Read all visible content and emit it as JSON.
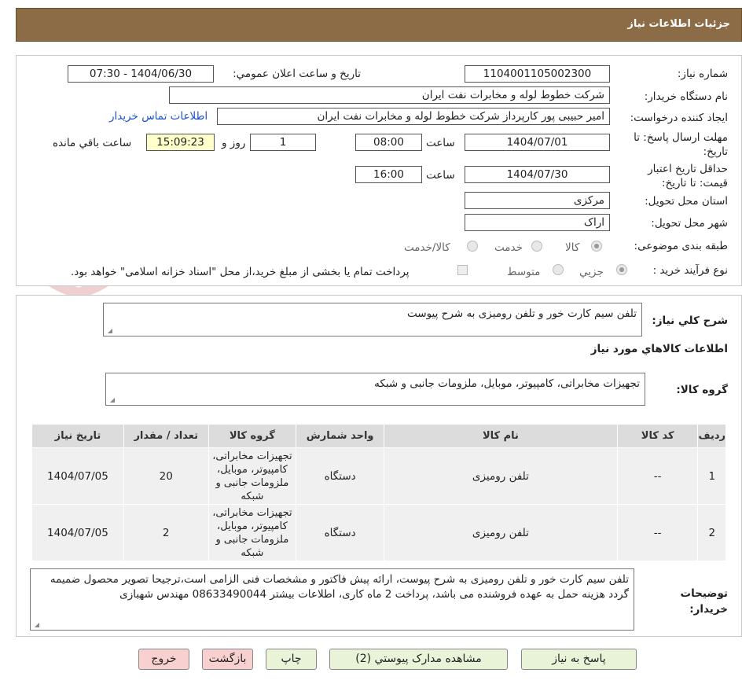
{
  "header": {
    "title": "جزئیات اطلاعات نیاز"
  },
  "form": {
    "need_number_label": "شماره نیاز:",
    "need_number": "1104001105002300",
    "announce_label": "تاریخ و ساعت اعلان عمومي:",
    "announce_value": "1404/06/30 - 07:30",
    "buyer_org_label": "نام دستگاه خریدار:",
    "buyer_org": "شرکت خطوط لوله و مخابرات نفت ایران",
    "requester_label": "ایجاد کننده درخواست:",
    "requester": "امیر  حبیبی پور  کارپرداز شرکت خطوط لوله و مخابرات نفت ایران",
    "contact_link": "اطلاعات تماس خریدار",
    "reply_deadline_label": "مهلت ارسال پاسخ: تا تاریخ:",
    "reply_date": "1404/07/01",
    "time_label": "ساعت",
    "reply_time": "08:00",
    "days_value": "1",
    "days_label": "روز و",
    "remaining_time": "15:09:23",
    "remaining_label": "ساعت باقي مانده",
    "price_validity_label": "حداقل تاریخ اعتبار قیمت: تا تاریخ:",
    "price_date": "1404/07/30",
    "price_time": "16:00",
    "province_label": "استان محل تحویل:",
    "province": "مرکزی",
    "city_label": "شهر محل تحویل:",
    "city": "اراک",
    "category_label": "طبقه بندی موضوعی:",
    "category_options": [
      "کالا",
      "خدمت",
      "کالا/خدمت"
    ],
    "process_label": "نوع فرآیند خرید :",
    "process_options": [
      "جزیي",
      "متوسط"
    ],
    "treasury_note": "پرداخت تمام یا بخشی از مبلغ خرید،از محل \"اسناد خزانه اسلامی\" خواهد بود."
  },
  "summary": {
    "general_desc_label": "شرح کلي نیاز:",
    "general_desc": "تلفن سیم کارت خور و تلفن رومیزی به شرح پیوست",
    "goods_info_title": "اطلاعات کالاهاي مورد نیاز",
    "goods_group_label": "گروه کالا:",
    "goods_group": "تجهیزات مخابراتی، کامپیوتر، موبایل، ملزومات جانبی و شبکه"
  },
  "table": {
    "headers": [
      "ردیف",
      "کد کالا",
      "نام کالا",
      "واحد شمارش",
      "گروه کالا",
      "تعداد / مقدار",
      "تاریخ نیاز"
    ],
    "rows": [
      [
        "1",
        "--",
        "تلفن رومیزی",
        "دستگاه",
        "تجهیزات مخابراتی، کامپیوتر، موبایل، ملزومات جانبی و شبکه",
        "20",
        "1404/07/05"
      ],
      [
        "2",
        "--",
        "تلفن رومیزی",
        "دستگاه",
        "تجهیزات مخابراتی، کامپیوتر، موبایل، ملزومات جانبی و شبکه",
        "2",
        "1404/07/05"
      ]
    ]
  },
  "buyer_notes": {
    "label": "توضیحات خریدار:",
    "text": "تلفن سیم کارت خور و تلفن رومیزی به شرح پیوست، ارائه پیش فاکتور و مشخصات فنی الزامی است،ترجیحا تصویر محصول ضمیمه گردد هزینه حمل به عهده فروشنده می باشد، پرداخت 2 ماه کاری، اطلاعات بیشتر 08633490044 مهندس شهبازی"
  },
  "buttons": {
    "reply": "پاسخ به نیاز",
    "attachments": "مشاهده مدارک پیوستي (2)",
    "print": "چاپ",
    "back": "بازگشت",
    "exit": "خروج"
  },
  "colors": {
    "header_bg": "#8b6c47",
    "link": "#1a4fd6",
    "button_green": "#e9f3d8",
    "button_pink": "#f8d0d0"
  }
}
